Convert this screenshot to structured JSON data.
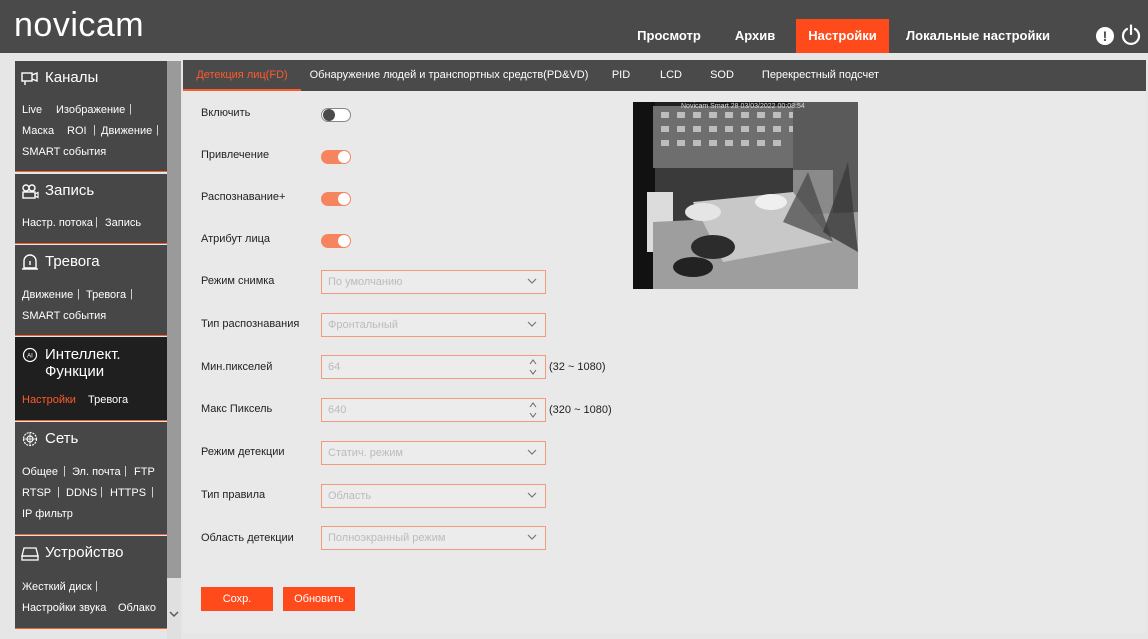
{
  "app": {
    "logo": "novicam"
  },
  "topnav": {
    "tabs": [
      {
        "label": "Просмотр",
        "active": false
      },
      {
        "label": "Архив",
        "active": false
      },
      {
        "label": "Настройки",
        "active": true
      },
      {
        "label": "Локальные настройки",
        "active": false
      }
    ],
    "alert_glyph": "!"
  },
  "sidebar": {
    "sections": [
      {
        "title": "Каналы",
        "icon": "channels-icon",
        "items": [
          "Live",
          "Изображение",
          "Маска",
          "ROI",
          "Движение",
          "SMART события"
        ]
      },
      {
        "title": "Запись",
        "icon": "record-icon",
        "items": [
          "Настр. потока",
          "Запись"
        ]
      },
      {
        "title": "Тревога",
        "icon": "alarm-icon",
        "items": [
          "Движение",
          "Тревога",
          "SMART события"
        ]
      },
      {
        "title": "Интеллект. Функции",
        "title_line1": "Интеллект.",
        "title_line2": "Функции",
        "icon": "ai-icon",
        "active": true,
        "items": [
          "Настройки",
          "Тревога"
        ]
      },
      {
        "title": "Сеть",
        "icon": "network-icon",
        "items": [
          "Общее",
          "Эл. почта",
          "FTP",
          "RTSP",
          "DDNS",
          "HTTPS",
          "IP фильтр"
        ]
      },
      {
        "title": "Устройство",
        "icon": "device-icon",
        "items": [
          "Жесткий диск",
          "Настройки звука",
          "Облако"
        ]
      }
    ],
    "pipe": "|"
  },
  "content": {
    "tabs": [
      {
        "label": "Детекция лиц(FD)",
        "active": true
      },
      {
        "label": "Обнаружение людей и транспортных средств(PD&VD)",
        "active": false
      },
      {
        "label": "PID",
        "active": false
      },
      {
        "label": "LCD",
        "active": false
      },
      {
        "label": "SOD",
        "active": false
      },
      {
        "label": "Перекрестный подсчет",
        "active": false
      }
    ],
    "form": {
      "enable": {
        "label": "Включить",
        "on": false
      },
      "attraction": {
        "label": "Привлечение",
        "on": true
      },
      "recognition_plus": {
        "label": "Распознавание+",
        "on": true
      },
      "face_attribute": {
        "label": "Атрибут лица",
        "on": true
      },
      "snapshot_mode": {
        "label": "Режим снимка",
        "value": "По умолчанию"
      },
      "recognition_type": {
        "label": "Тип распознавания",
        "value": "Фронтальный"
      },
      "min_pixels": {
        "label": "Мин.пикселей",
        "value": "64",
        "range": "(32 ~ 1080)"
      },
      "max_pixels": {
        "label": "Макс Пиксель",
        "value": "640",
        "range": "(320 ~ 1080)"
      },
      "detection_mode": {
        "label": "Режим детекции",
        "value": "Статич. режим"
      },
      "rule_type": {
        "label": "Тип правила",
        "value": "Область"
      },
      "detection_area": {
        "label": "Область детекции",
        "value": "Полноэкранный режим"
      }
    },
    "buttons": {
      "save": "Сохр.",
      "refresh": "Обновить"
    },
    "preview": {
      "timestamp": "Novicam Smart 28 03/03/2022 00:08:54"
    }
  },
  "colors": {
    "accent": "#ff4a1c",
    "header": "#4a4a4a",
    "sidebar_section": "#474747",
    "sidebar_active": "#1f1f1f"
  }
}
